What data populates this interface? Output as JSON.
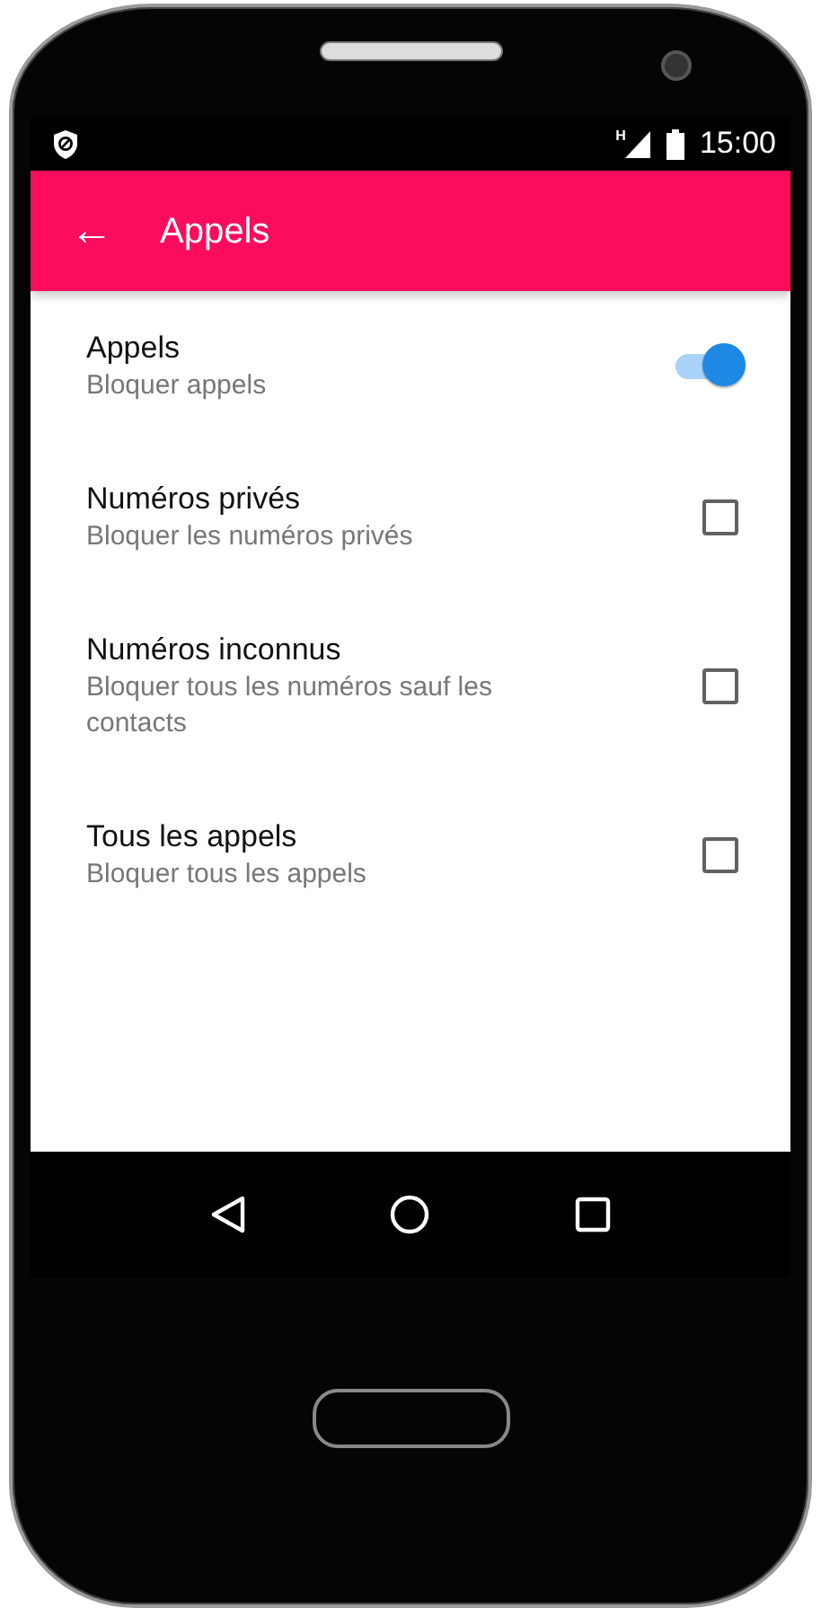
{
  "status_bar": {
    "network_type": "H",
    "time": "15:00"
  },
  "app_bar": {
    "back": "←",
    "title": "Appels"
  },
  "settings": [
    {
      "kind": "switch",
      "title": "Appels",
      "summary": "Bloquer appels",
      "on": true
    },
    {
      "kind": "checkbox",
      "title": "Numéros privés",
      "summary": "Bloquer les numéros privés",
      "checked": false
    },
    {
      "kind": "checkbox",
      "title": "Numéros inconnus",
      "summary": "Bloquer tous les numéros sauf les contacts",
      "checked": false
    },
    {
      "kind": "checkbox",
      "title": "Tous les appels",
      "summary": "Bloquer tous les appels",
      "checked": false
    }
  ]
}
